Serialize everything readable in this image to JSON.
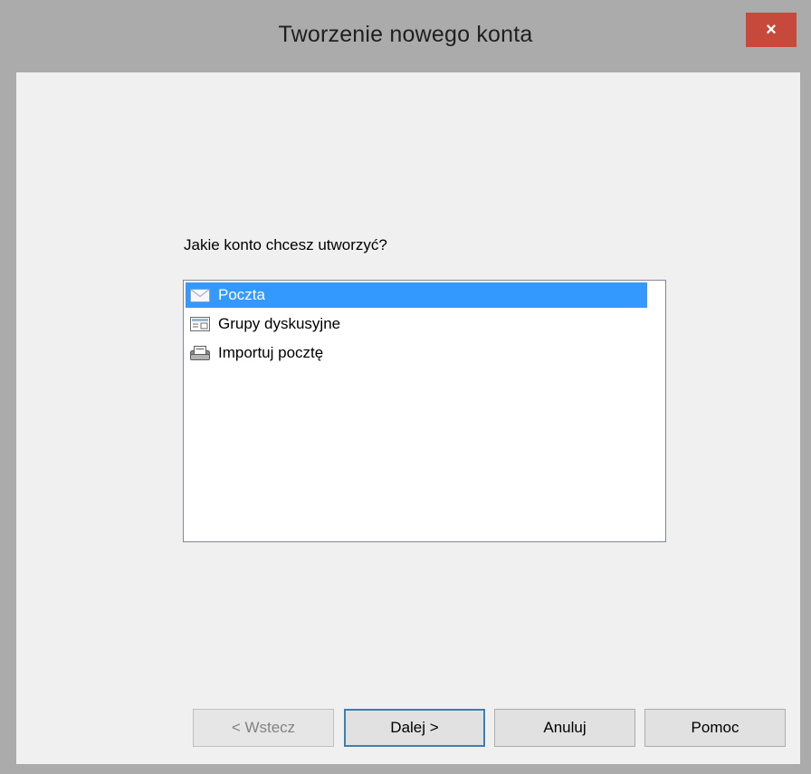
{
  "window": {
    "title": "Tworzenie nowego konta",
    "close_label": "×"
  },
  "main": {
    "question": "Jakie konto chcesz utworzyć?",
    "account_types": [
      {
        "label": "Poczta",
        "icon": "mail-icon",
        "selected": true
      },
      {
        "label": "Grupy dyskusyjne",
        "icon": "newsgroup-icon",
        "selected": false
      },
      {
        "label": "Importuj pocztę",
        "icon": "import-mail-icon",
        "selected": false
      }
    ]
  },
  "buttons": {
    "back_label": "< Wstecz",
    "next_label": "Dalej >",
    "cancel_label": "Anuluj",
    "help_label": "Pomoc"
  },
  "colors": {
    "titlebar": "#ababab",
    "close": "#c7493b",
    "selection": "#3399ff"
  }
}
